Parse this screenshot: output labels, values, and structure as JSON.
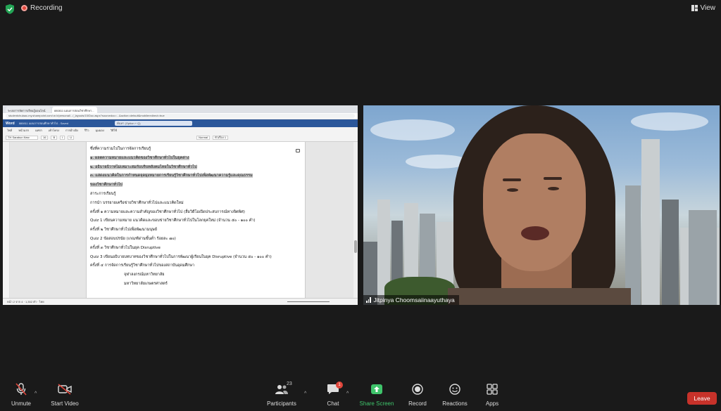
{
  "topbar": {
    "recording_label": "Recording",
    "view_label": "View"
  },
  "shared_screen": {
    "browser_tabs": [
      "ระบบการจัดการเรียนรู้ออนไลน์",
      "880811 แผนการสอนวิชาศึกษา...",
      ""
    ],
    "address": "studentchulaac-my.sharepoint.com/:w:/r/personal/.../_layouts/15/Doc.aspx?sourcedoc=...&action=default&mobileredirect=true",
    "app_name": "Word",
    "doc_title": "880811 แผนการสอนศึกษาทั่วไป - Saved",
    "search_placeholder": "ค้นหา (Option + Q)",
    "menu_items": [
      "ไฟล์",
      "หน้าแรก",
      "แทรก",
      "เค้าโครง",
      "การอ้างอิง",
      "รีวิว",
      "มุมมอง",
      "วิธีใช้"
    ],
    "ribbon_items": [
      "TH Sarabun New",
      "16",
      "B",
      "I",
      "U",
      "Normal",
      "หัวเรื่อง 1"
    ],
    "lines": [
      "ซึ่งที่ความร่วมไปในการจัดการเรียนรู้",
      "๑. ผลตความหมายและแนวคิดของวิชาศึกษาทั่วไปในยุคต่าง",
      "๒. อธิบายบิวาทไม่เหมาะสมกับบริบทสังคมไทยในวิชาศึกษาทั่วไป",
      "๓. แสดงแนวคิดในการกำหนดจุดมุ่งหมายการเรียนรู้วิชาศึกษาทั่วไปเพื่อพัฒนาความรู้และคุณธรรม",
      "ของวิชาศึกษาทั่วไป",
      "สาระการเรียนรู้",
      "การนำ บรรยายเครือข่ายวิชาศึกษาทั่วไปและแนวคิดใหม่",
      "ครั้งที่ ๑ ความหมายและความสำคัญของวิชาศึกษาทั่วไป (สื่อวิดีโอเปิดประสบการณ์ทางจิตพิศ)",
      "Quiz 1 เขียนความหมาย แนวคิดและขอบข่ายวิชาศึกษาทั่วไปในโลกยุคใหม่ (จำนวน ๕๐ - ๑๐๐ คำ)",
      "ครั้งที่ ๒ วิชาศึกษาทั่วไปเพื่อพัฒนามนุษย์",
      "Quiz 2 ข้อสอบปรนัย (เกณฑ์ผ่านขั้นต่ำ ร้อยละ ๗๐)",
      "ครั้งที่ ๓ วิชาศึกษาทั่วไปในยุค Disruptive",
      "Quiz 3 เขียนอธิบายบทบาทของวิชาศึกษาทั่วไปในการพัฒนาผู้เรียนในยุค Disruptive (จำนวน ๕๐ - ๑๐๐ คำ)",
      "ครั้งที่ ๔ การจัดการเรียนรู้วิชาศึกษาทั่วไปของสถาบันอุดมศึกษา",
      "จุฬาลงกรณ์มหาวิทยาลัย",
      "มหาวิทยาลัยเกษตรศาสตร์"
    ],
    "status_text": "หน้า 2 จาก 4 · 1,352 คำ · ไทย"
  },
  "video": {
    "participant_name": "Jitpinya Choomsaiinaayuthaya"
  },
  "toolbar": {
    "unmute": "Unmute",
    "start_video": "Start Video",
    "participants": "Participants",
    "participants_count": "23",
    "chat": "Chat",
    "chat_badge": "1",
    "share_screen": "Share Screen",
    "record": "Record",
    "reactions": "Reactions",
    "apps": "Apps",
    "leave": "Leave"
  },
  "colors": {
    "accent_green": "#3fc46b",
    "leave_red": "#c7322a",
    "word_blue": "#2b579a"
  }
}
